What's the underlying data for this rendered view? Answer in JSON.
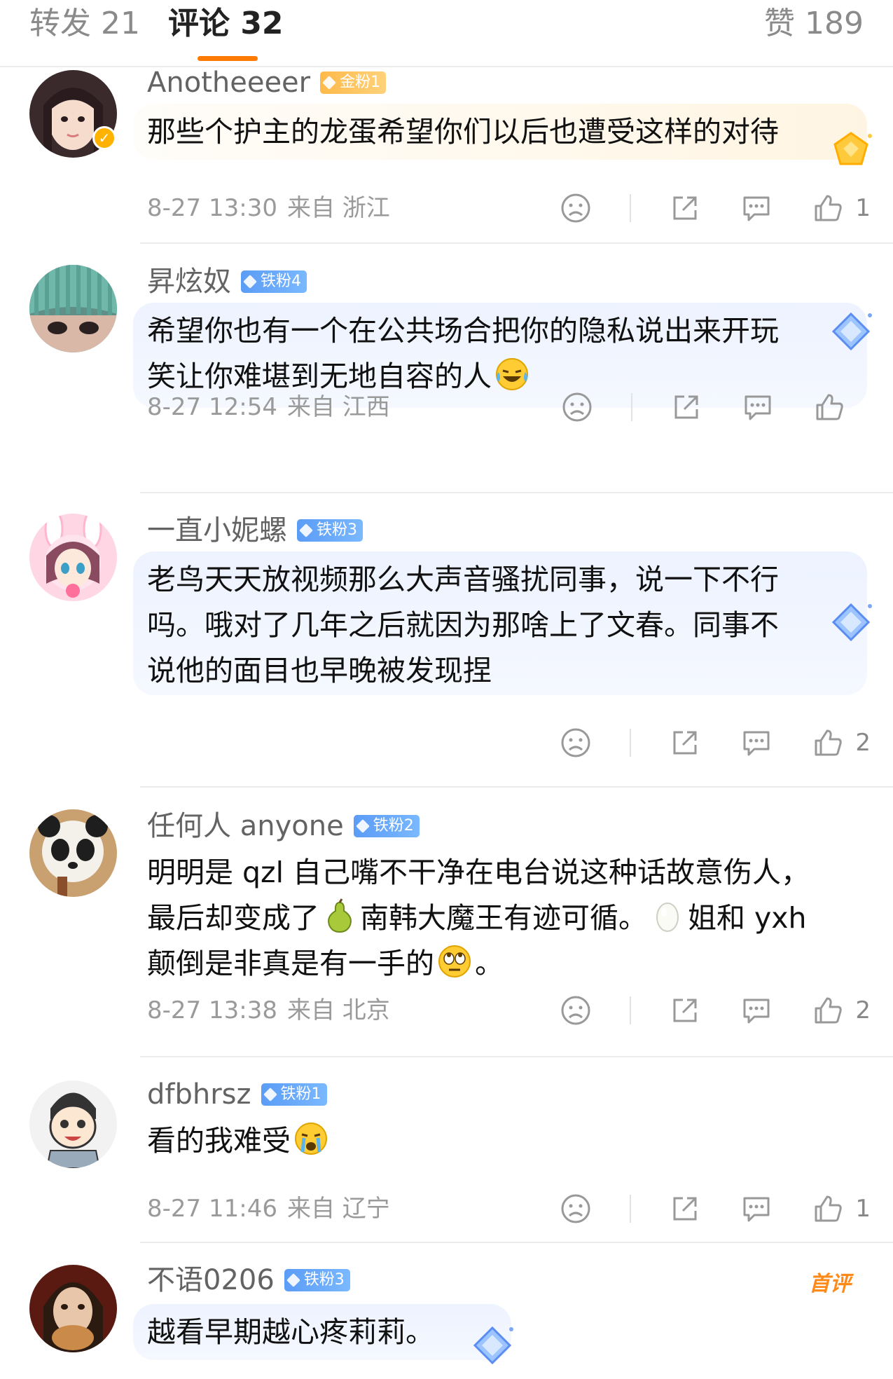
{
  "tabs": {
    "repost": "转发 21",
    "comments": "评论 32",
    "likes": "赞 189"
  },
  "colors": {
    "accent": "#ff7a00",
    "iron_badge": "#5b9cf6",
    "gold_badge": "#ffb94a"
  },
  "comments": [
    {
      "username": "Anotheeeer",
      "badge": "金粉1",
      "badge_type": "gold",
      "verified": true,
      "text": "那些个护主的龙蛋希望你们以后也遭受这样的对待",
      "time": "8-27 13:30",
      "source": "来自 浙江",
      "likes": "1"
    },
    {
      "username": "昇炫奴",
      "badge": "铁粉4",
      "badge_type": "iron",
      "text_lines": [
        "希望你也有一个在公共场合把你的隐私说出来开玩",
        "笑让你难堪到无地自容的人"
      ],
      "emoji": "laughing-crying-emoji",
      "time": "8-27 12:54",
      "source": "来自 江西",
      "likes": ""
    },
    {
      "username": "一直小妮螺",
      "badge": "铁粉3",
      "badge_type": "iron",
      "text_lines": [
        "老鸟天天放视频那么大声音骚扰同事，说一下不行",
        "吗。哦对了几年之后就因为那啥上了文春。同事不",
        "说他的面目也早晚被发现捏"
      ],
      "time": "",
      "source": "",
      "likes": "2"
    },
    {
      "username": "任何人 anyone",
      "badge": "铁粉2",
      "badge_type": "iron",
      "text_line1": "明明是 qzl 自己嘴不干净在电台说这种话故意伤人，",
      "text_line2_a": "最后却变成了",
      "text_line2_b": "南韩大魔王有迹可循。",
      "text_line2_c": "姐和 yxh",
      "text_line3_a": "颠倒是非真是有一手的",
      "text_line3_b": "。",
      "emojis": [
        "pear-emoji",
        "egg-emoji",
        "eye-roll-emoji"
      ],
      "time": "8-27 13:38",
      "source": "来自 北京",
      "likes": "2"
    },
    {
      "username": "dfbhrsz",
      "badge": "铁粉1",
      "badge_type": "iron",
      "text": "看的我难受",
      "emoji": "crying-emoji",
      "time": "8-27 11:46",
      "source": "来自 辽宁",
      "likes": "1"
    },
    {
      "username": "不语0206",
      "badge": "铁粉3",
      "badge_type": "iron",
      "tag": "首评",
      "text": "越看早期越心疼莉莉。"
    }
  ]
}
